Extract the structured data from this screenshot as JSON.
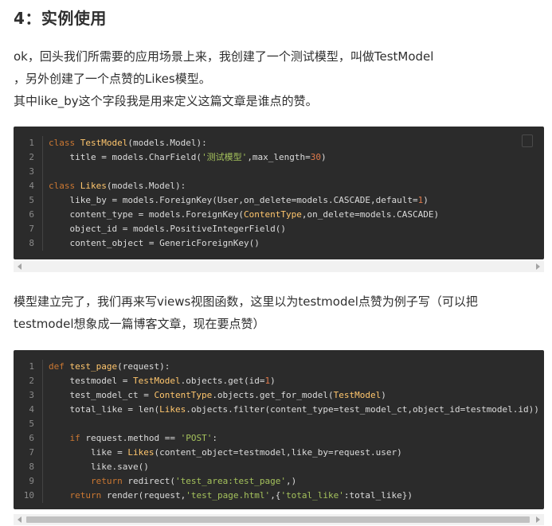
{
  "heading": "4：实例使用",
  "para1": {
    "line1": "ok，回头我们所需要的应用场景上来，我创建了一个测试模型，叫做TestModel",
    "line2": "，另外创建了一个点赞的Likes模型。",
    "line3": "其中like_by这个字段我是用来定义这篇文章是谁点的赞。"
  },
  "para2": {
    "line1": "模型建立完了，我们再来写views视图函数，这里以为testmodel点赞为例子写（可以把",
    "line2": "testmodel想象成一篇博客文章，现在要点赞）"
  },
  "code1": {
    "line_numbers": [
      "1",
      "2",
      "3",
      "4",
      "5",
      "6",
      "7",
      "8"
    ],
    "lines": [
      "class TestModel(models.Model):",
      "    title = models.CharField('测试模型',max_length=30)",
      "",
      "class Likes(models.Model):",
      "    like_by = models.ForeignKey(User,on_delete=models.CASCADE,default=1)",
      "    content_type = models.ForeignKey(ContentType,on_delete=models.CASCADE)",
      "    object_id = models.PositiveIntegerField()",
      "    content_object = GenericForeignKey()"
    ]
  },
  "code2": {
    "line_numbers": [
      "1",
      "2",
      "3",
      "4",
      "5",
      "6",
      "7",
      "8",
      "9",
      "10"
    ],
    "lines": [
      "def test_page(request):",
      "    testmodel = TestModel.objects.get(id=1)",
      "    test_model_ct = ContentType.objects.get_for_model(TestModel)",
      "    total_like = len(Likes.objects.filter(content_type=test_model_ct,object_id=testmodel.id))",
      "",
      "    if request.method == 'POST':",
      "        like = Likes(content_object=testmodel,like_by=request.user)",
      "        like.save()",
      "        return redirect('test_area:test_page',)",
      "    return render(request,'test_page.html',{'total_like':total_like})"
    ]
  },
  "icons": {
    "copy": "copy-icon",
    "scroll_left": "chevron-left-icon",
    "scroll_right": "chevron-right-icon"
  },
  "colors": {
    "code_bg": "#2b2b2b",
    "keyword": "#cc7832",
    "class_name": "#ffc66d",
    "string": "#a5c25c",
    "number": "#e07a4c"
  }
}
